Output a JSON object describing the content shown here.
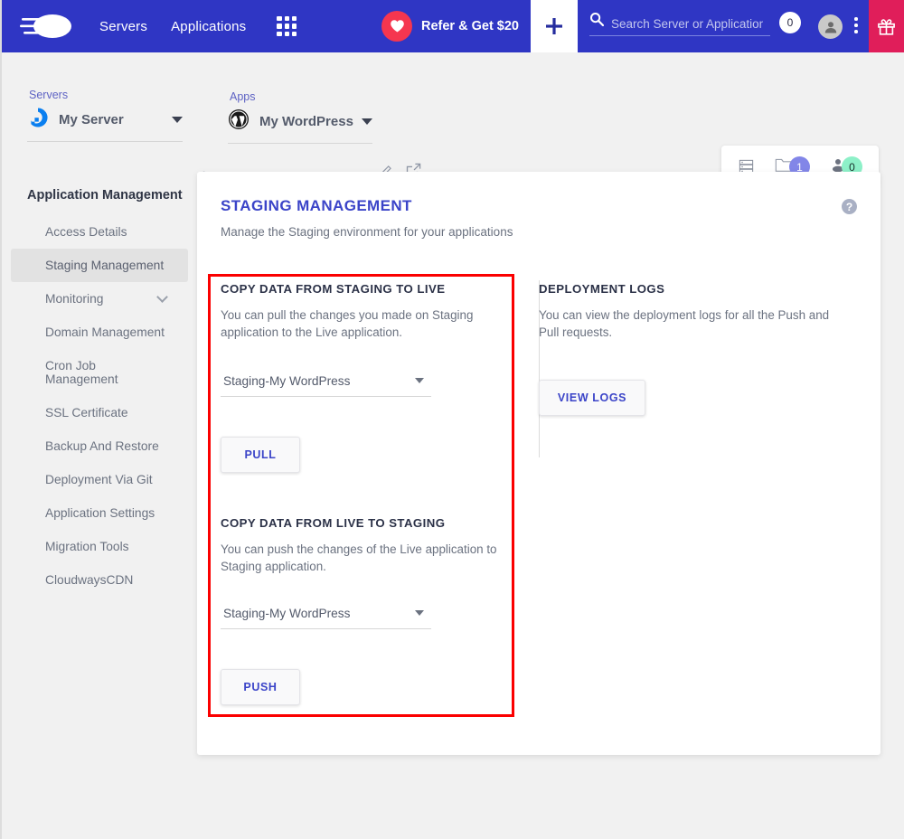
{
  "topnav": {
    "logo_name": "cloudways-logo",
    "links": [
      {
        "label": "Servers",
        "name": "nav-link-servers"
      },
      {
        "label": "Applications",
        "name": "nav-link-applications"
      }
    ],
    "grid_icon": "apps-grid-icon",
    "refer": {
      "label": "Refer & Get $20",
      "icon": "heart-icon"
    },
    "plus_icon": "plus-icon",
    "search": {
      "placeholder": "Search Server or Application",
      "value": "",
      "icon": "search-icon",
      "count": "0"
    },
    "avatar_icon": "user-avatar-icon",
    "kebab_icon": "more-vertical-icon",
    "gift_icon": "gift-icon",
    "colors": {
      "nav_bg": "#2f36c4",
      "gift_bg": "#e01e5a",
      "heart_bg": "#f5364f"
    }
  },
  "breadcrumb": {
    "server": {
      "label": "Servers",
      "name": "My Server",
      "icon": "server-droplet-icon"
    },
    "separator": "›",
    "app": {
      "label": "Apps",
      "name": "My WordPress",
      "icon": "wordpress-icon"
    },
    "actions": [
      {
        "name": "edit-pencil-icon"
      },
      {
        "name": "open-external-icon"
      }
    ],
    "badges": [
      {
        "name": "server-stack-icon",
        "value": ""
      },
      {
        "name": "folder-icon",
        "value": "1",
        "color": "#8286e8"
      },
      {
        "name": "team-member-icon",
        "value": "0",
        "color": "#8df0c8"
      }
    ]
  },
  "sidebar": {
    "title": "Application Management",
    "items": [
      {
        "label": "Access Details",
        "active": false,
        "expandable": false
      },
      {
        "label": "Staging Management",
        "active": true,
        "expandable": false
      },
      {
        "label": "Monitoring",
        "active": false,
        "expandable": true
      },
      {
        "label": "Domain Management",
        "active": false,
        "expandable": false
      },
      {
        "label": "Cron Job Management",
        "active": false,
        "expandable": false
      },
      {
        "label": "SSL Certificate",
        "active": false,
        "expandable": false
      },
      {
        "label": "Backup And Restore",
        "active": false,
        "expandable": false
      },
      {
        "label": "Deployment Via Git",
        "active": false,
        "expandable": false
      },
      {
        "label": "Application Settings",
        "active": false,
        "expandable": false
      },
      {
        "label": "Migration Tools",
        "active": false,
        "expandable": false
      },
      {
        "label": "CloudwaysCDN",
        "active": false,
        "expandable": false
      }
    ]
  },
  "panel": {
    "title": "STAGING MANAGEMENT",
    "subtitle": "Manage the Staging environment for your applications",
    "help_icon": "help-question-icon",
    "help_glyph": "?",
    "highlight_color": "#fb0000",
    "pull_section": {
      "title": "COPY DATA FROM STAGING TO LIVE",
      "description": "You can pull the changes you made on Staging application to the Live application.",
      "select_value": "Staging-My WordPress",
      "button_label": "PULL"
    },
    "push_section": {
      "title": "COPY DATA FROM LIVE TO STAGING",
      "description": "You can push the changes of the Live application to Staging application.",
      "select_value": "Staging-My WordPress",
      "button_label": "PUSH"
    },
    "logs_section": {
      "title": "DEPLOYMENT LOGS",
      "description": "You can view the deployment logs for all the Push and Pull requests.",
      "button_label": "VIEW LOGS"
    }
  }
}
